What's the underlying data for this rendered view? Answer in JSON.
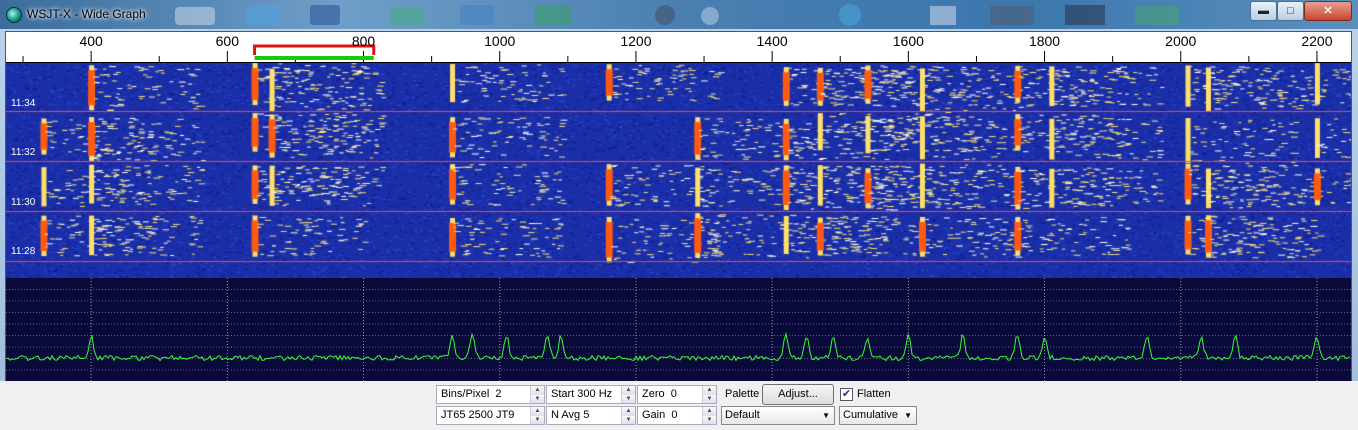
{
  "window": {
    "title": "WSJT-X - Wide Graph",
    "icons": {
      "app": "wsjtx-logo-icon",
      "minimize": "minimize-icon",
      "maximize": "maximize-icon",
      "close": "close-icon"
    }
  },
  "ruler": {
    "ticks": [
      "400",
      "600",
      "800",
      "1000",
      "1200",
      "1400",
      "1600",
      "1800",
      "2000",
      "2200"
    ],
    "tick_hz": [
      400,
      600,
      800,
      1000,
      1200,
      1400,
      1600,
      1800,
      2000,
      2200
    ],
    "range_hz": [
      275,
      2250
    ],
    "rx_marker_hz": [
      640,
      815
    ],
    "tx_marker_hz": [
      640,
      815
    ],
    "rx_marker_color": "#e01010",
    "tx_marker_color": "#11cc11"
  },
  "waterfall": {
    "time_labels": [
      "11:34",
      "11:32",
      "11:30",
      "11:28"
    ],
    "background_color": "#1a2ea8",
    "signal_hz": [
      330,
      400,
      640,
      665,
      930,
      1160,
      1290,
      1420,
      1470,
      1540,
      1620,
      1760,
      1810,
      2010,
      2040,
      2200
    ]
  },
  "spectrum": {
    "line_color": "#33ff33",
    "grid_color": "#ffffff",
    "background_color": "#0a0a3a",
    "peaks_hz": [
      400,
      930,
      960,
      1010,
      1070,
      1090,
      1420,
      1450,
      1490,
      1540,
      1600,
      1680,
      1760,
      1800,
      1950,
      2030,
      2080,
      2200
    ]
  },
  "controls": {
    "bins_label": "Bins/Pixel",
    "bins_value": "2",
    "start_label": "Start",
    "start_value": "300 Hz",
    "zero_label": "Zero",
    "zero_value": "0",
    "mode_value": "JT65  2500  JT9",
    "navg_label": "N Avg",
    "navg_value": "5",
    "gain_label": "Gain",
    "gain_value": "0",
    "palette_label": "Palette",
    "adjust_label": "Adjust...",
    "flatten_label": "Flatten",
    "flatten_checked": "✔",
    "palette_value": "Default",
    "spectrum_mode_value": "Cumulative"
  }
}
